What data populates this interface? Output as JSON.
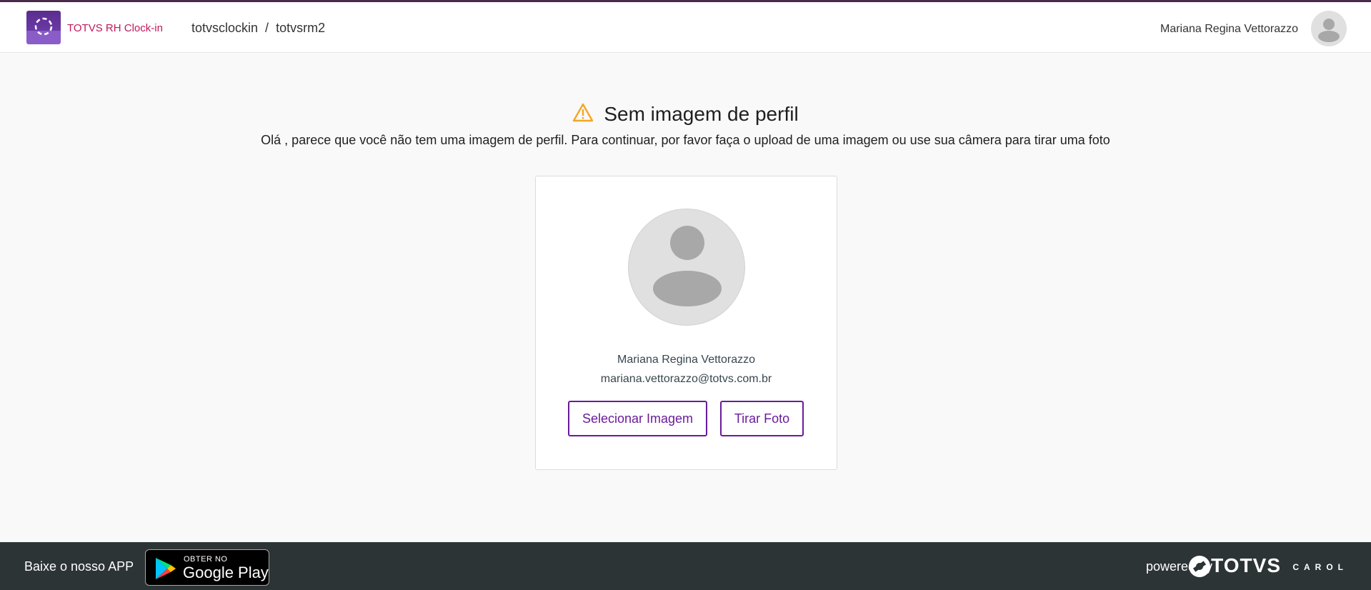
{
  "header": {
    "app_name": "TOTVS RH Clock-in",
    "breadcrumb": [
      "totvsclockin",
      "totvsrm2"
    ],
    "breadcrumb_separator": "/",
    "user_name": "Mariana Regina Vettorazzo"
  },
  "main": {
    "title": "Sem imagem de perfil",
    "subtitle": "Olá , parece que você não tem uma imagem de perfil. Para continuar, por favor faça o upload de uma imagem ou use sua câmera para tirar uma foto",
    "card": {
      "name": "Mariana Regina Vettorazzo",
      "email": "mariana.vettorazzo@totvs.com.br",
      "select_button": "Selecionar Imagem",
      "photo_button": "Tirar Foto"
    }
  },
  "footer": {
    "download_text": "Baixe o nosso APP",
    "store_small": "OBTER NO",
    "store_big": "Google Play",
    "powered_by": "powered by",
    "brand": "TOTVS",
    "brand_sub": "CAROL"
  },
  "colors": {
    "accent": "#6a1b9a",
    "app_name": "#c2185b",
    "warning": "#f5a623",
    "footer_bg": "#2d3436"
  },
  "icons": [
    "logo-icon",
    "user-avatar-icon",
    "warning-icon",
    "profile-placeholder-icon",
    "google-play-icon",
    "totvs-logo-icon"
  ]
}
